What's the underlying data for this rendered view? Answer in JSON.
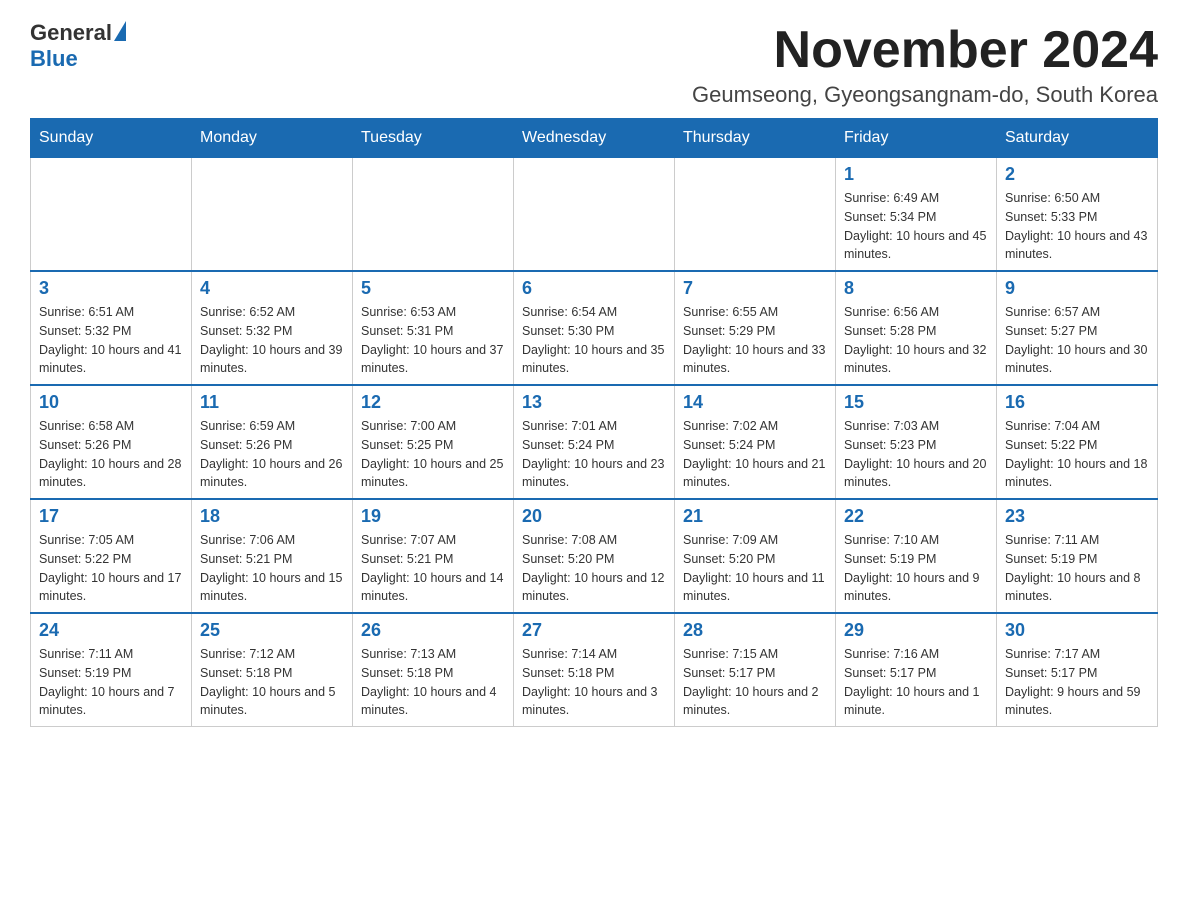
{
  "logo": {
    "text1": "General",
    "text2": "Blue"
  },
  "title": "November 2024",
  "location": "Geumseong, Gyeongsangnam-do, South Korea",
  "days_of_week": [
    "Sunday",
    "Monday",
    "Tuesday",
    "Wednesday",
    "Thursday",
    "Friday",
    "Saturday"
  ],
  "weeks": [
    [
      {
        "day": "",
        "info": ""
      },
      {
        "day": "",
        "info": ""
      },
      {
        "day": "",
        "info": ""
      },
      {
        "day": "",
        "info": ""
      },
      {
        "day": "",
        "info": ""
      },
      {
        "day": "1",
        "info": "Sunrise: 6:49 AM\nSunset: 5:34 PM\nDaylight: 10 hours and 45 minutes."
      },
      {
        "day": "2",
        "info": "Sunrise: 6:50 AM\nSunset: 5:33 PM\nDaylight: 10 hours and 43 minutes."
      }
    ],
    [
      {
        "day": "3",
        "info": "Sunrise: 6:51 AM\nSunset: 5:32 PM\nDaylight: 10 hours and 41 minutes."
      },
      {
        "day": "4",
        "info": "Sunrise: 6:52 AM\nSunset: 5:32 PM\nDaylight: 10 hours and 39 minutes."
      },
      {
        "day": "5",
        "info": "Sunrise: 6:53 AM\nSunset: 5:31 PM\nDaylight: 10 hours and 37 minutes."
      },
      {
        "day": "6",
        "info": "Sunrise: 6:54 AM\nSunset: 5:30 PM\nDaylight: 10 hours and 35 minutes."
      },
      {
        "day": "7",
        "info": "Sunrise: 6:55 AM\nSunset: 5:29 PM\nDaylight: 10 hours and 33 minutes."
      },
      {
        "day": "8",
        "info": "Sunrise: 6:56 AM\nSunset: 5:28 PM\nDaylight: 10 hours and 32 minutes."
      },
      {
        "day": "9",
        "info": "Sunrise: 6:57 AM\nSunset: 5:27 PM\nDaylight: 10 hours and 30 minutes."
      }
    ],
    [
      {
        "day": "10",
        "info": "Sunrise: 6:58 AM\nSunset: 5:26 PM\nDaylight: 10 hours and 28 minutes."
      },
      {
        "day": "11",
        "info": "Sunrise: 6:59 AM\nSunset: 5:26 PM\nDaylight: 10 hours and 26 minutes."
      },
      {
        "day": "12",
        "info": "Sunrise: 7:00 AM\nSunset: 5:25 PM\nDaylight: 10 hours and 25 minutes."
      },
      {
        "day": "13",
        "info": "Sunrise: 7:01 AM\nSunset: 5:24 PM\nDaylight: 10 hours and 23 minutes."
      },
      {
        "day": "14",
        "info": "Sunrise: 7:02 AM\nSunset: 5:24 PM\nDaylight: 10 hours and 21 minutes."
      },
      {
        "day": "15",
        "info": "Sunrise: 7:03 AM\nSunset: 5:23 PM\nDaylight: 10 hours and 20 minutes."
      },
      {
        "day": "16",
        "info": "Sunrise: 7:04 AM\nSunset: 5:22 PM\nDaylight: 10 hours and 18 minutes."
      }
    ],
    [
      {
        "day": "17",
        "info": "Sunrise: 7:05 AM\nSunset: 5:22 PM\nDaylight: 10 hours and 17 minutes."
      },
      {
        "day": "18",
        "info": "Sunrise: 7:06 AM\nSunset: 5:21 PM\nDaylight: 10 hours and 15 minutes."
      },
      {
        "day": "19",
        "info": "Sunrise: 7:07 AM\nSunset: 5:21 PM\nDaylight: 10 hours and 14 minutes."
      },
      {
        "day": "20",
        "info": "Sunrise: 7:08 AM\nSunset: 5:20 PM\nDaylight: 10 hours and 12 minutes."
      },
      {
        "day": "21",
        "info": "Sunrise: 7:09 AM\nSunset: 5:20 PM\nDaylight: 10 hours and 11 minutes."
      },
      {
        "day": "22",
        "info": "Sunrise: 7:10 AM\nSunset: 5:19 PM\nDaylight: 10 hours and 9 minutes."
      },
      {
        "day": "23",
        "info": "Sunrise: 7:11 AM\nSunset: 5:19 PM\nDaylight: 10 hours and 8 minutes."
      }
    ],
    [
      {
        "day": "24",
        "info": "Sunrise: 7:11 AM\nSunset: 5:19 PM\nDaylight: 10 hours and 7 minutes."
      },
      {
        "day": "25",
        "info": "Sunrise: 7:12 AM\nSunset: 5:18 PM\nDaylight: 10 hours and 5 minutes."
      },
      {
        "day": "26",
        "info": "Sunrise: 7:13 AM\nSunset: 5:18 PM\nDaylight: 10 hours and 4 minutes."
      },
      {
        "day": "27",
        "info": "Sunrise: 7:14 AM\nSunset: 5:18 PM\nDaylight: 10 hours and 3 minutes."
      },
      {
        "day": "28",
        "info": "Sunrise: 7:15 AM\nSunset: 5:17 PM\nDaylight: 10 hours and 2 minutes."
      },
      {
        "day": "29",
        "info": "Sunrise: 7:16 AM\nSunset: 5:17 PM\nDaylight: 10 hours and 1 minute."
      },
      {
        "day": "30",
        "info": "Sunrise: 7:17 AM\nSunset: 5:17 PM\nDaylight: 9 hours and 59 minutes."
      }
    ]
  ]
}
